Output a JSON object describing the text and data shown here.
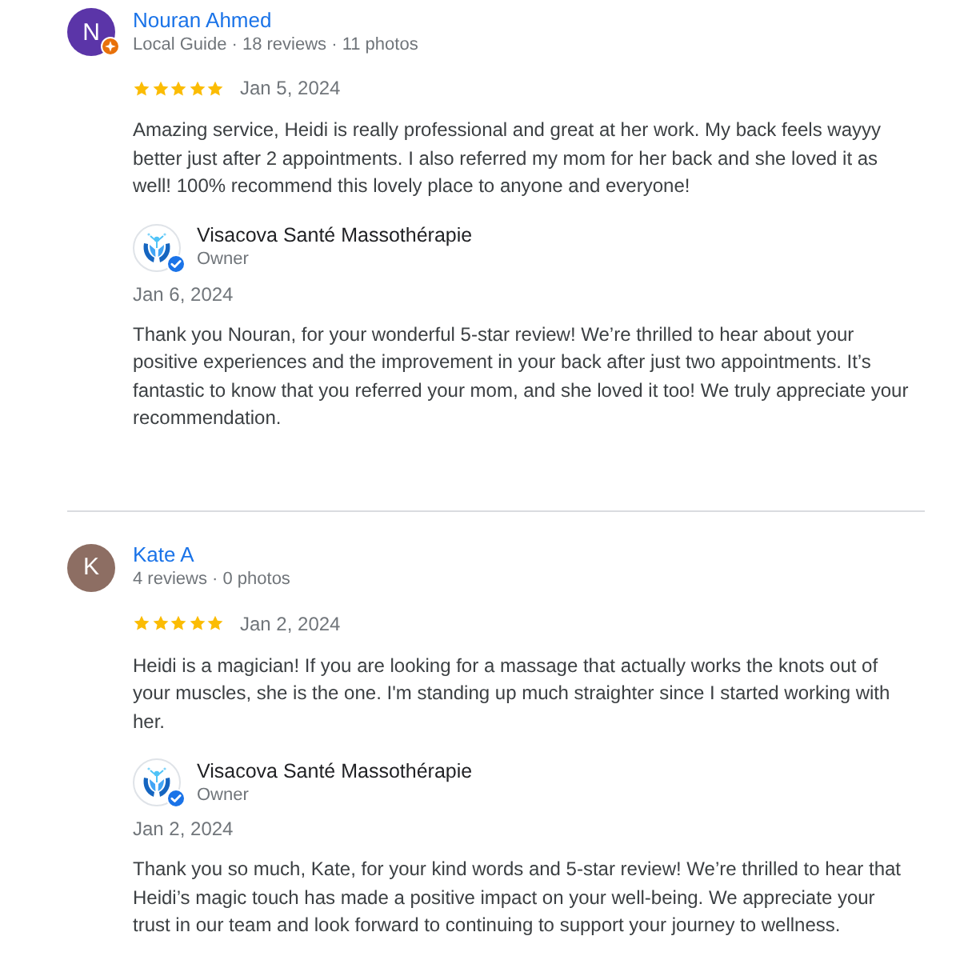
{
  "reviews": [
    {
      "reviewer": {
        "avatar": {
          "letter": "N",
          "color": "#5b35a8",
          "local_guide_badge": true
        },
        "name": "Nouran Ahmed",
        "meta": "Local Guide · 18 reviews · 11 photos"
      },
      "stars": 5,
      "date": "Jan 5, 2024",
      "text": "Amazing service, Heidi is really professional and great at her work. My back feels wayyy better just after 2 appointments. I also referred my mom for her back and she loved it as well! 100% recommend this lovely place to anyone and everyone!",
      "reply": {
        "owner_name": "Visacova Santé Massothérapie",
        "role": "Owner",
        "date": "Jan 6, 2024",
        "text": "Thank you Nouran, for your wonderful 5-star review! We’re thrilled to hear about your positive experiences and the improvement in your back after just two appointments. It’s fantastic to know that you referred your mom, and she loved it too! We truly appreciate your recommendation."
      }
    },
    {
      "reviewer": {
        "avatar": {
          "letter": "K",
          "color": "#8d6e63",
          "local_guide_badge": false
        },
        "name": "Kate A",
        "meta": "4 reviews · 0 photos"
      },
      "stars": 5,
      "date": "Jan 2, 2024",
      "text": "Heidi is a magician! If you are looking for a massage that actually works the knots out of your muscles, she is the one. I'm standing up much straighter since I started working with her.",
      "reply": {
        "owner_name": "Visacova Santé Massothérapie",
        "role": "Owner",
        "date": "Jan 2, 2024",
        "text": "Thank you so much, Kate, for your kind words and 5-star review! We’re thrilled to hear that Heidi’s magic touch has made a positive impact on your well-being. We appreciate your trust in our team and look forward to continuing to support your journey to wellness."
      }
    }
  ]
}
